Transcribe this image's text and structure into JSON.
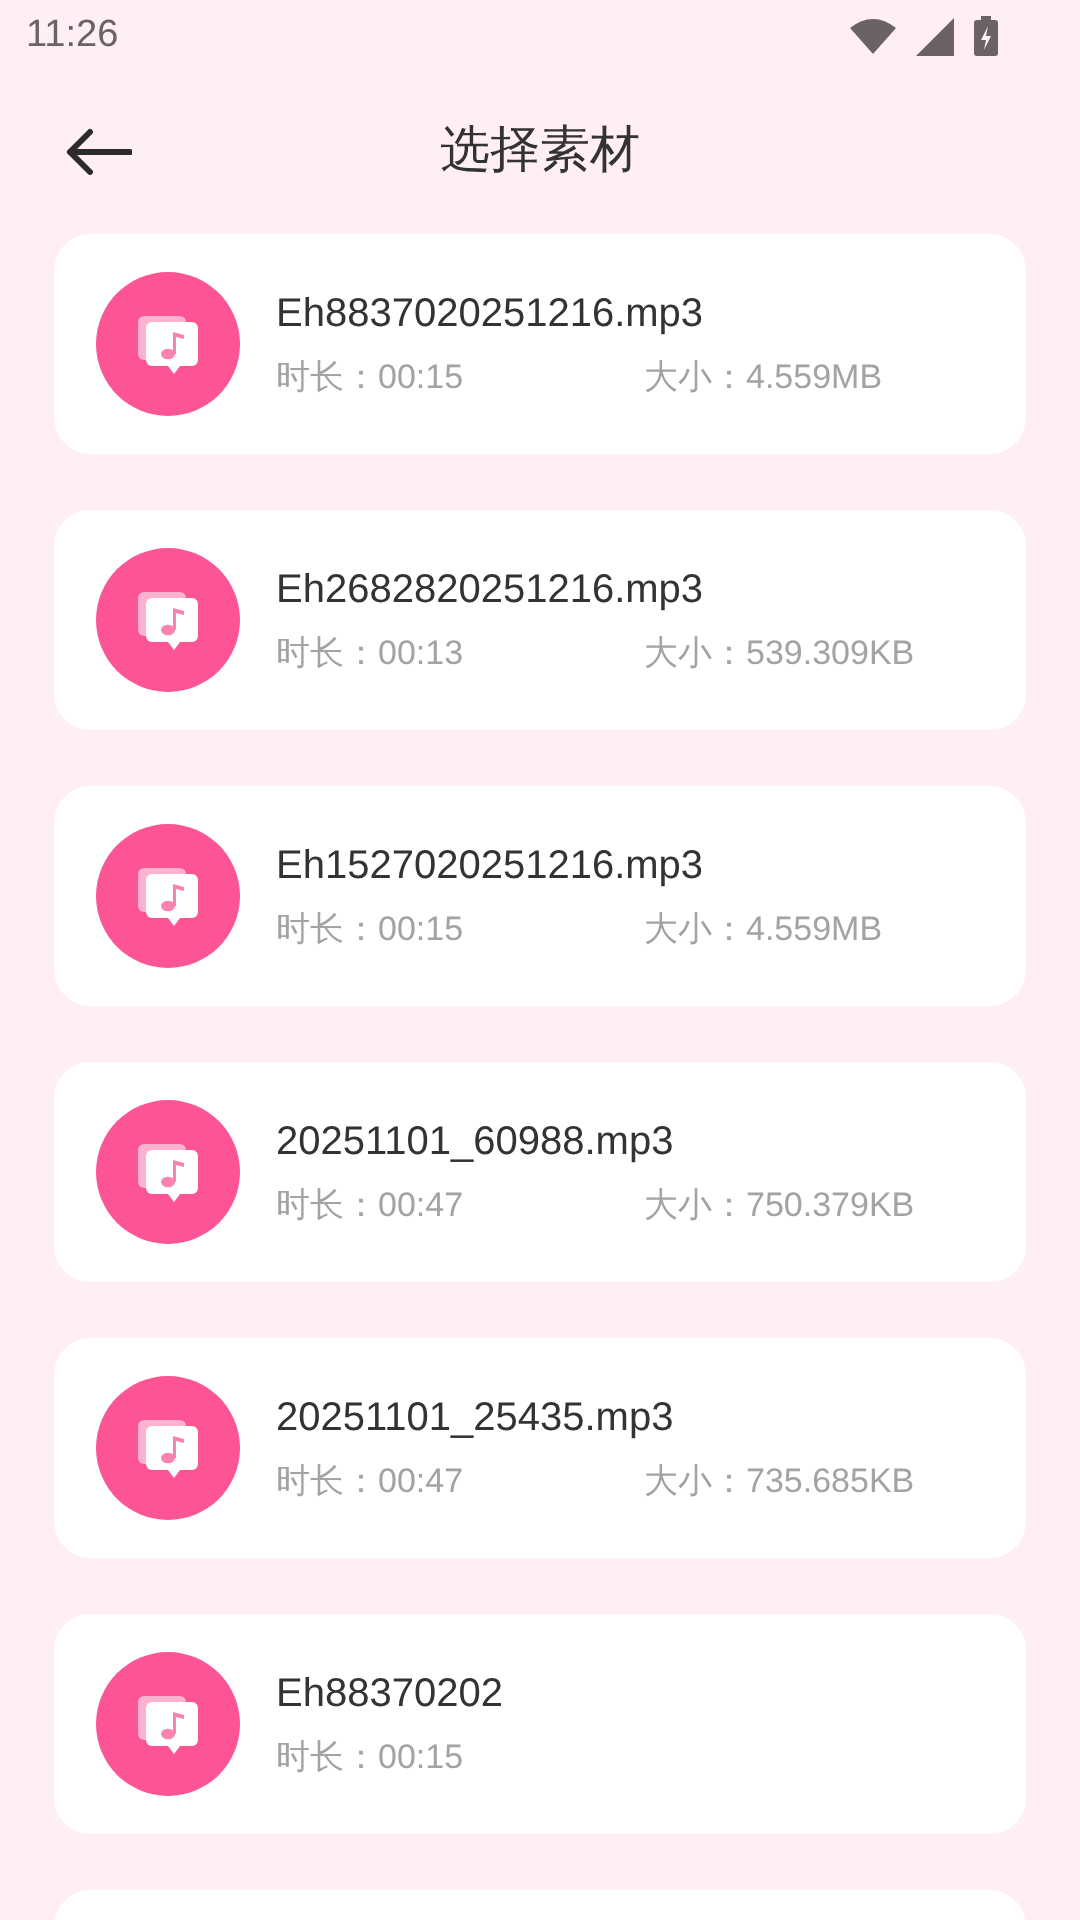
{
  "status_bar": {
    "time": "11:26"
  },
  "header": {
    "title": "选择素材"
  },
  "files": [
    {
      "name": "Eh8837020251216.mp3",
      "duration": "时长：00:15",
      "size": "大小：4.559MB"
    },
    {
      "name": "Eh2682820251216.mp3",
      "duration": "时长：00:13",
      "size": "大小：539.309KB"
    },
    {
      "name": "Eh1527020251216.mp3",
      "duration": "时长：00:15",
      "size": "大小：4.559MB"
    },
    {
      "name": "20251101_60988.mp3",
      "duration": "时长：00:47",
      "size": "大小：750.379KB"
    },
    {
      "name": "20251101_25435.mp3",
      "duration": "时长：00:47",
      "size": "大小：735.685KB"
    },
    {
      "name": "Eh88370202",
      "duration": "时长：00:15"
    }
  ]
}
